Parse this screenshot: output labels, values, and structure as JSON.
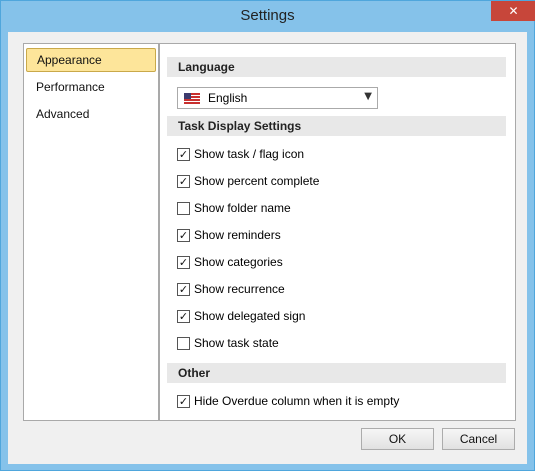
{
  "window": {
    "title": "Settings",
    "close_glyph": "✕"
  },
  "sidebar": {
    "items": [
      {
        "label": "Appearance",
        "selected": true
      },
      {
        "label": "Performance",
        "selected": false
      },
      {
        "label": "Advanced",
        "selected": false
      }
    ]
  },
  "language": {
    "header": "Language",
    "selected": "English",
    "flag_icon": "us-flag-icon"
  },
  "task_display": {
    "header": "Task Display Settings",
    "items": [
      {
        "label": "Show task / flag icon",
        "checked": true
      },
      {
        "label": "Show percent complete",
        "checked": true
      },
      {
        "label": "Show folder name",
        "checked": false
      },
      {
        "label": "Show reminders",
        "checked": true
      },
      {
        "label": "Show categories",
        "checked": true
      },
      {
        "label": "Show recurrence",
        "checked": true
      },
      {
        "label": "Show delegated sign",
        "checked": true
      },
      {
        "label": "Show task state",
        "checked": false
      }
    ]
  },
  "other": {
    "header": "Other",
    "items": [
      {
        "label": "Hide Overdue column when it is empty",
        "checked": true
      }
    ]
  },
  "buttons": {
    "ok": "OK",
    "cancel": "Cancel"
  },
  "colors": {
    "title_bar": "#85c2ea",
    "close_button": "#c7463a",
    "selected_item": "#fde59a"
  }
}
